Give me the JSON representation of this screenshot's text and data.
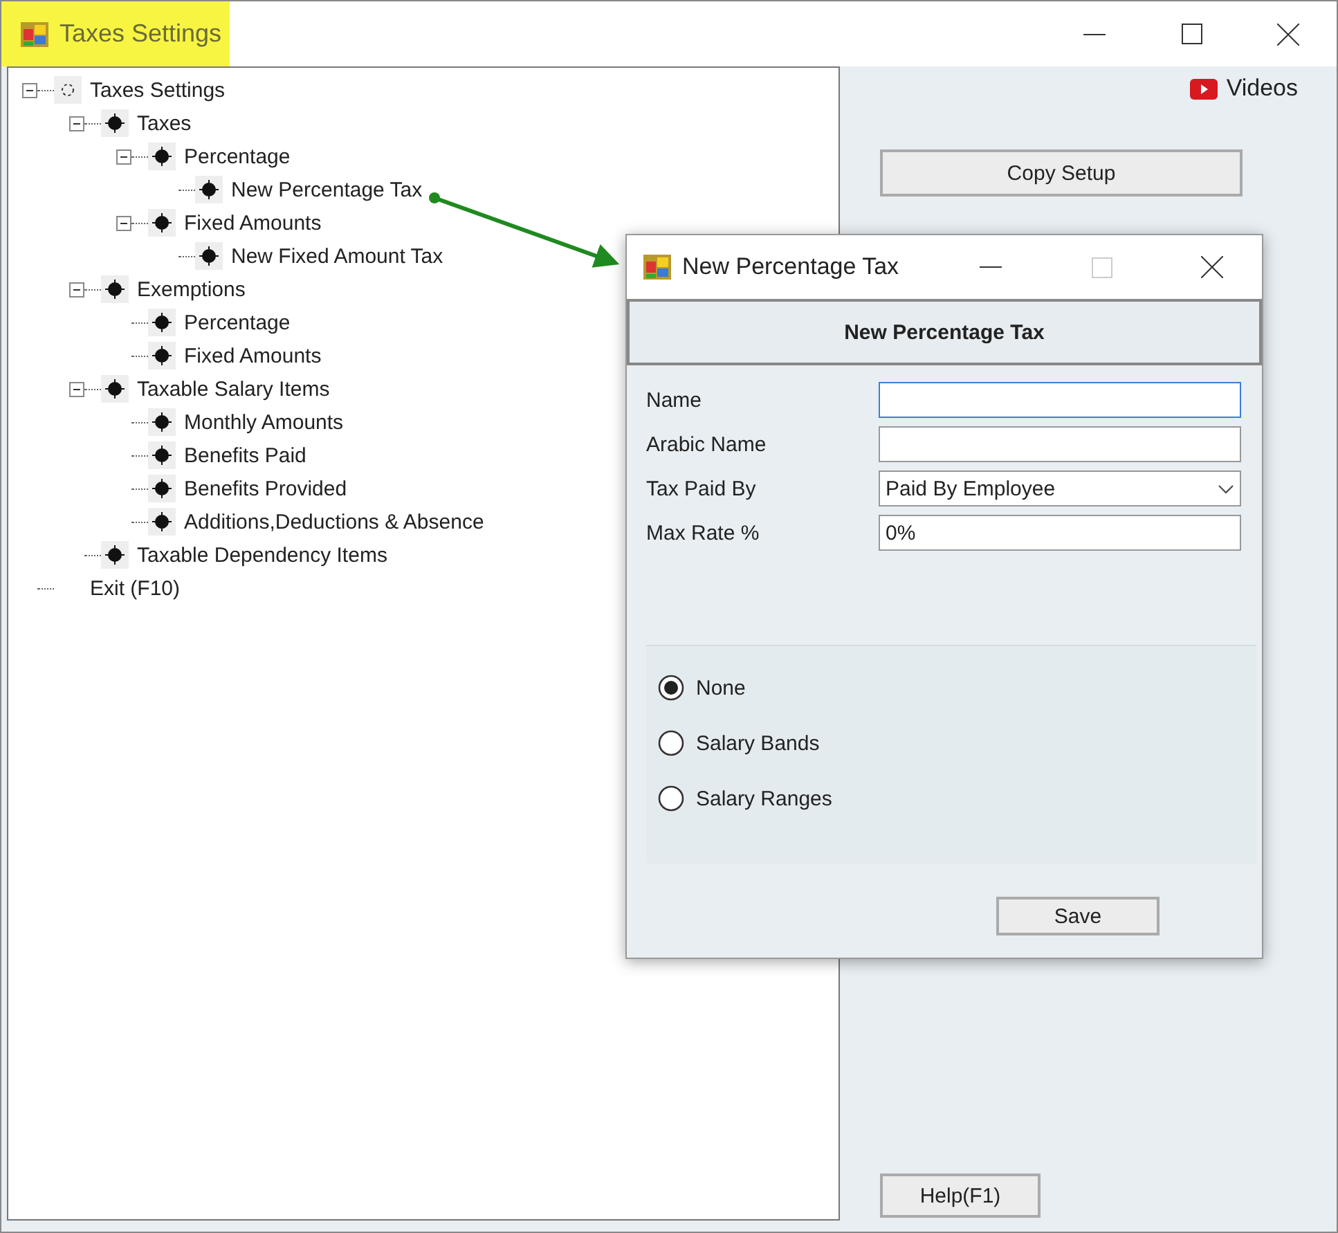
{
  "window": {
    "title": "Taxes Settings"
  },
  "tree": [
    {
      "label": "Taxes Settings",
      "kind": "root",
      "expanded": true,
      "children": [
        {
          "label": "Taxes",
          "kind": "node",
          "expanded": true,
          "children": [
            {
              "label": "Percentage",
              "kind": "node",
              "expanded": true,
              "children": [
                {
                  "label": "New Percentage Tax",
                  "kind": "node"
                }
              ]
            },
            {
              "label": "Fixed Amounts",
              "kind": "node",
              "expanded": true,
              "children": [
                {
                  "label": "New Fixed Amount Tax",
                  "kind": "node"
                }
              ]
            }
          ]
        },
        {
          "label": "Exemptions",
          "kind": "node",
          "expanded": true,
          "children": [
            {
              "label": "Percentage",
              "kind": "node"
            },
            {
              "label": "Fixed Amounts",
              "kind": "node"
            }
          ]
        },
        {
          "label": "Taxable Salary Items",
          "kind": "node",
          "expanded": true,
          "children": [
            {
              "label": "Monthly Amounts",
              "kind": "node"
            },
            {
              "label": "Benefits Paid",
              "kind": "node"
            },
            {
              "label": "Benefits Provided",
              "kind": "node"
            },
            {
              "label": "Additions,Deductions & Absence",
              "kind": "node"
            }
          ]
        },
        {
          "label": "Taxable Dependency Items",
          "kind": "node"
        }
      ]
    },
    {
      "label": "Exit (F10)",
      "kind": "action"
    }
  ],
  "side": {
    "videos": "Videos",
    "copy_button": "Copy Setup",
    "help_button": "Help(F1)"
  },
  "dialog": {
    "title": "New Percentage Tax",
    "header": "New Percentage Tax",
    "fields": [
      {
        "label": "Name",
        "kind": "text",
        "focused": true
      },
      {
        "label": "Arabic Name",
        "kind": "text",
        "focused": false
      },
      {
        "label": "Tax Paid By",
        "kind": "select",
        "value": "Paid By Employee",
        "focused": false
      },
      {
        "label": "Max Rate %",
        "kind": "text",
        "value": "0%",
        "focused": false
      }
    ],
    "options": [
      {
        "label": "None",
        "selected": true
      },
      {
        "label": "Salary Bands",
        "selected": false
      },
      {
        "label": "Salary Ranges",
        "selected": false
      }
    ],
    "save_button": "Save"
  }
}
